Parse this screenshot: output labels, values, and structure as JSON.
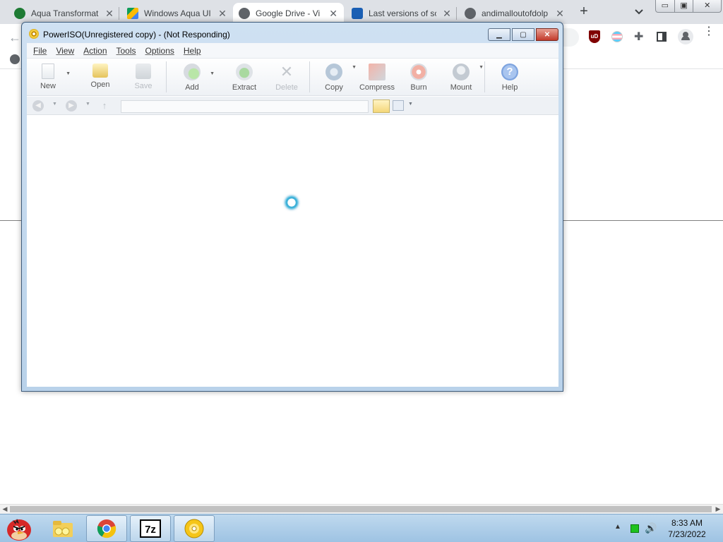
{
  "browser": {
    "tabs": [
      {
        "title": "Aqua Transformat",
        "favicon_color": "#1e7b34",
        "close": "✕"
      },
      {
        "title": "Windows Aqua UI",
        "favicon_color": "#fbbc04",
        "close": "✕"
      },
      {
        "title": "Google Drive - Vi",
        "favicon_color": "#5f6368",
        "close": "✕",
        "active": true
      },
      {
        "title": "Last versions of sc",
        "favicon_color": "#1a5fb4",
        "close": "✕"
      },
      {
        "title": "andimalloutofdolp",
        "favicon_color": "#5f6368",
        "close": "✕"
      }
    ],
    "new_tab_label": "+",
    "tab_search_icon": "chevron-down-icon",
    "window_controls": {
      "minimize": "▭",
      "restore": "▣",
      "close": "✕"
    },
    "back_icon": "←",
    "extensions": {
      "ublock": "uD"
    },
    "menu_icon": "⋮",
    "scroll_left": "◀",
    "scroll_right": "▶"
  },
  "poweriso": {
    "title": "PowerISO(Unregistered copy) -  (Not Responding)",
    "window_controls": {
      "minimize": "▁",
      "maximize": "▢",
      "close": "✕"
    },
    "menu": [
      "File",
      "View",
      "Action",
      "Tools",
      "Options",
      "Help"
    ],
    "toolbar": {
      "new": "New",
      "open": "Open",
      "save": "Save",
      "add": "Add",
      "extract": "Extract",
      "delete": "Delete",
      "copy": "Copy",
      "compress": "Compress",
      "burn": "Burn",
      "mount": "Mount",
      "help": "Help"
    },
    "path_value": "",
    "nav": {
      "back": "◀",
      "forward": "▶",
      "up": "↑"
    }
  },
  "taskbar": {
    "clock_time": "8:33 AM",
    "clock_date": "7/23/2022",
    "tray_arrow": "▲",
    "volume_icon": "🔊"
  }
}
